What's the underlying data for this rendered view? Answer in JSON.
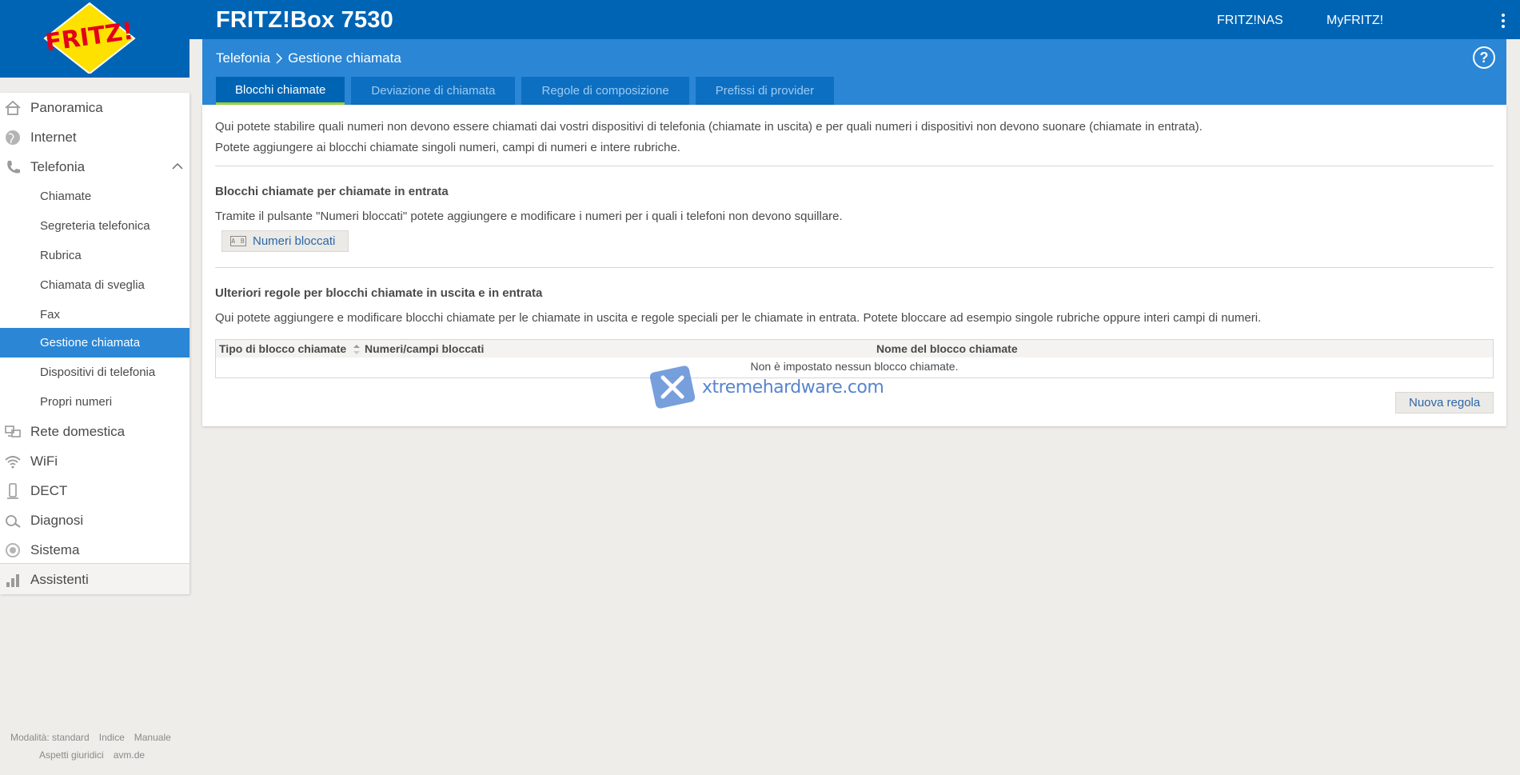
{
  "header": {
    "product_title": "FRITZ!Box 7530",
    "links": [
      "FRITZ!NAS",
      "MyFRITZ!"
    ],
    "logo_text": "FRITZ!",
    "colors": {
      "brand_blue": "#0064b4",
      "band_blue": "#2b86d6",
      "logo_red": "#e2001a",
      "logo_yellow": "#ffe100"
    }
  },
  "breadcrumb": {
    "parent": "Telefonia",
    "current": "Gestione chiamata",
    "help": "?"
  },
  "tabs": [
    {
      "label": "Blocchi chiamate",
      "active": true
    },
    {
      "label": "Deviazione di chiamata",
      "active": false
    },
    {
      "label": "Regole di composizione",
      "active": false
    },
    {
      "label": "Prefissi di provider",
      "active": false
    }
  ],
  "sidebar": {
    "items": [
      {
        "label": "Panoramica",
        "icon": "home-icon"
      },
      {
        "label": "Internet",
        "icon": "globe-icon"
      },
      {
        "label": "Telefonia",
        "icon": "phone-icon",
        "expanded": true
      },
      {
        "label": "Rete domestica",
        "icon": "network-icon"
      },
      {
        "label": "WiFi",
        "icon": "wifi-icon"
      },
      {
        "label": "DECT",
        "icon": "dect-icon"
      },
      {
        "label": "Diagnosi",
        "icon": "diagnosis-icon"
      },
      {
        "label": "Sistema",
        "icon": "system-icon"
      },
      {
        "label": "Assistenti",
        "icon": "wizard-icon"
      }
    ],
    "sub_items": [
      {
        "label": "Chiamate"
      },
      {
        "label": "Segreteria telefonica"
      },
      {
        "label": "Rubrica"
      },
      {
        "label": "Chiamata di sveglia"
      },
      {
        "label": "Fax"
      },
      {
        "label": "Gestione chiamata",
        "active": true
      },
      {
        "label": "Dispositivi di telefonia"
      },
      {
        "label": "Propri numeri"
      }
    ]
  },
  "content": {
    "intro_line1": "Qui potete stabilire quali numeri non devono essere chiamati dai vostri dispositivi di telefonia (chiamate in uscita) e per quali numeri i dispositivi non devono suonare (chiamate in entrata).",
    "intro_line2": "Potete aggiungere ai blocchi chiamate singoli numeri, campi di numeri e intere rubriche.",
    "incoming_title": "Blocchi chiamate per chiamate in entrata",
    "incoming_text": "Tramite il pulsante \"Numeri bloccati\" potete aggiungere e modificare i numeri per i quali i telefoni non devono squillare.",
    "blocked_button": "Numeri bloccati",
    "blocked_button_icon": "A B",
    "rules_title": "Ulteriori regole per blocchi chiamate in uscita e in entrata",
    "rules_text": "Qui potete aggiungere e modificare blocchi chiamate per le chiamate in uscita e regole speciali per le chiamate in entrata. Potete bloccare ad esempio singole rubriche oppure interi campi di numeri.",
    "table": {
      "headers": [
        "Tipo di blocco chiamate",
        "Numeri/campi bloccati",
        "Nome del blocco chiamate"
      ],
      "empty": "Non è impostato nessun blocco chiamate."
    },
    "new_rule_button": "Nuova regola"
  },
  "watermark": {
    "text": "xtremehardware.com"
  },
  "footer": {
    "row1": [
      "Modalità: standard",
      "Indice",
      "Manuale"
    ],
    "row2": [
      "Aspetti giuridici",
      "avm.de"
    ]
  }
}
